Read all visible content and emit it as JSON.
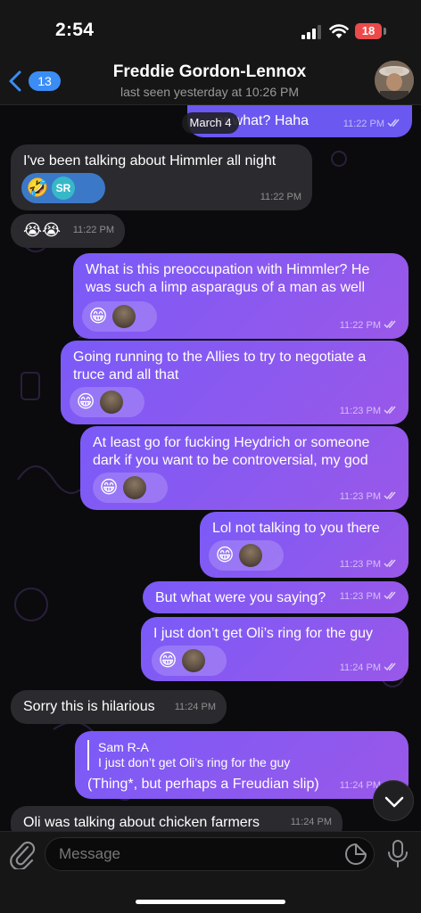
{
  "status": {
    "time": "2:54",
    "battery": "18"
  },
  "header": {
    "back_count": "13",
    "title": "Freddie Gordon-Lennox",
    "subtitle": "last seen yesterday at 10:26 PM"
  },
  "chat": {
    "date_pill": "March 4",
    "messages": [
      {
        "dir": "out",
        "text": "er what? Haha",
        "time": "11:22 PM"
      },
      {
        "dir": "in",
        "text": "I've been talking about Himmler all night",
        "time": "11:22 PM",
        "reactions": [
          "🤣",
          "SR"
        ]
      },
      {
        "dir": "in",
        "text": "😭😭",
        "time": "11:22 PM"
      },
      {
        "dir": "out",
        "text": "What is this preoccupation with Himmler? He was such a limp asparagus of a man as well",
        "time": "11:22 PM",
        "reactions": [
          "😁",
          "avatar"
        ]
      },
      {
        "dir": "out",
        "text": "Going running to the Allies to try to negotiate a truce and all that",
        "time": "11:23 PM",
        "reactions": [
          "😁",
          "avatar"
        ]
      },
      {
        "dir": "out",
        "text": "At least go for fucking Heydrich or someone dark if you want to be controversial, my god",
        "time": "11:23 PM",
        "reactions": [
          "😁",
          "avatar"
        ]
      },
      {
        "dir": "out",
        "text": "Lol not talking to you there",
        "time": "11:23 PM",
        "reactions": [
          "😁",
          "avatar"
        ]
      },
      {
        "dir": "out",
        "text": "But what were you saying?",
        "time": "11:23 PM"
      },
      {
        "dir": "out",
        "text": "I just don’t get Oli’s ring for the guy",
        "time": "11:24 PM",
        "reactions": [
          "😁",
          "avatar"
        ]
      },
      {
        "dir": "in",
        "text": "Sorry this is hilarious",
        "time": "11:24 PM"
      },
      {
        "dir": "out",
        "reply_name": "Sam R-A",
        "reply_text": "I just don’t get Oli’s ring for the guy",
        "text": "(Thing*, but perhaps a Freudian slip)",
        "time": "11:24 PM"
      },
      {
        "dir": "in",
        "text": "Oli was talking about chicken farmers",
        "time": "11:24 PM"
      }
    ]
  },
  "input": {
    "placeholder": "Message"
  },
  "icons": [
    "back-chevron-icon",
    "paperclip-icon",
    "sticker-icon",
    "microphone-icon",
    "chevron-down-icon",
    "double-check-icon",
    "signal-icon",
    "wifi-icon"
  ],
  "colors": {
    "outgoing": "#7a5af8",
    "incoming": "#2b2a2e",
    "accent": "#3b8df5",
    "background": "#0b0b0d"
  }
}
